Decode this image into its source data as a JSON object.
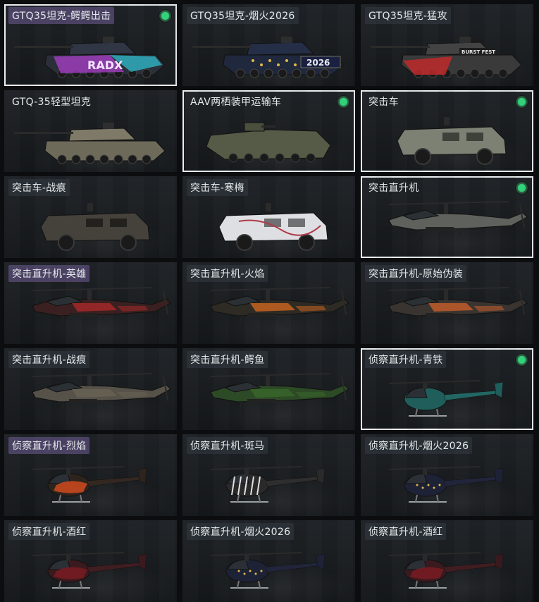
{
  "cards": [
    {
      "label": "GTQ35坦克-鳄鳄出击",
      "tier": "purple",
      "type": "tank",
      "skin": "neon",
      "equipped": true,
      "selected": true,
      "accent": "#c04cd8"
    },
    {
      "label": "GTQ35坦克-烟火2026",
      "tier": "dark",
      "type": "tank",
      "skin": "fireworks",
      "equipped": false,
      "selected": false,
      "accent": "#2d3a6a"
    },
    {
      "label": "GTQ35坦克-猛攻",
      "tier": "dark",
      "type": "tank",
      "skin": "assault",
      "equipped": false,
      "selected": false,
      "accent": "#b3282e"
    },
    {
      "label": "GTQ-35轻型坦克",
      "tier": "none",
      "type": "tank",
      "skin": "base",
      "equipped": false,
      "selected": false,
      "accent": "#6c6a5c"
    },
    {
      "label": "AAV两栖装甲运输车",
      "tier": "none",
      "type": "apc",
      "skin": "base",
      "equipped": true,
      "selected": true,
      "accent": "#5b6049"
    },
    {
      "label": "突击车",
      "tier": "none",
      "type": "truck",
      "skin": "base",
      "equipped": true,
      "selected": true,
      "accent": "#7b8073"
    },
    {
      "label": "突击车-战痕",
      "tier": "dark",
      "type": "truck",
      "skin": "scar",
      "equipped": false,
      "selected": false,
      "accent": "#4a4640"
    },
    {
      "label": "突击车-寒梅",
      "tier": "dark",
      "type": "truck",
      "skin": "plum",
      "equipped": false,
      "selected": false,
      "accent": "#e6e6e8"
    },
    {
      "label": "突击直升机",
      "tier": "none",
      "type": "attack-heli",
      "skin": "base",
      "equipped": true,
      "selected": true,
      "accent": "#6a6c68"
    },
    {
      "label": "突击直升机-英雄",
      "tier": "purple",
      "type": "attack-heli",
      "skin": "hero",
      "equipped": false,
      "selected": false,
      "accent": "#b22a2a"
    },
    {
      "label": "突击直升机-火焰",
      "tier": "dark",
      "type": "attack-heli",
      "skin": "flame",
      "equipped": false,
      "selected": false,
      "accent": "#d86a1e"
    },
    {
      "label": "突击直升机-原始伪装",
      "tier": "dark",
      "type": "attack-heli",
      "skin": "camo",
      "equipped": false,
      "selected": false,
      "accent": "#d2602a"
    },
    {
      "label": "突击直升机-战痕",
      "tier": "dark",
      "type": "attack-heli",
      "skin": "scar",
      "equipped": false,
      "selected": false,
      "accent": "#6a6454"
    },
    {
      "label": "突击直升机-鳄鱼",
      "tier": "dark",
      "type": "attack-heli",
      "skin": "croc",
      "equipped": false,
      "selected": false,
      "accent": "#3a6a2a"
    },
    {
      "label": "侦察直升机-青铁",
      "tier": "dark",
      "type": "scout-heli",
      "skin": "teal",
      "equipped": true,
      "selected": true,
      "accent": "#1e6a66"
    },
    {
      "label": "侦察直升机-烈焰",
      "tier": "purple",
      "type": "scout-heli",
      "skin": "blaze",
      "equipped": false,
      "selected": false,
      "accent": "#d04a1e"
    },
    {
      "label": "侦察直升机-斑马",
      "tier": "dark",
      "type": "scout-heli",
      "skin": "zebra",
      "equipped": false,
      "selected": false,
      "accent": "#d8d8d8"
    },
    {
      "label": "侦察直升机-烟火2026",
      "tier": "dark",
      "type": "scout-heli",
      "skin": "fireworks",
      "equipped": false,
      "selected": false,
      "accent": "#2a3868"
    },
    {
      "label": "侦察直升机-酒红",
      "tier": "dark",
      "type": "scout-heli",
      "skin": "wine",
      "equipped": false,
      "selected": false,
      "accent": "#7a1c22"
    },
    {
      "label": "侦察直升机-烟火2026",
      "tier": "dark",
      "type": "scout-heli",
      "skin": "fireworks",
      "equipped": false,
      "selected": false,
      "accent": "#2a3868"
    },
    {
      "label": "侦察直升机-酒红",
      "tier": "dark",
      "type": "scout-heli",
      "skin": "wine",
      "equipped": false,
      "selected": false,
      "accent": "#7a1c22"
    }
  ],
  "decals": {
    "neon": "RADX",
    "fireworks": "2026",
    "assault": "BURST FEST"
  }
}
